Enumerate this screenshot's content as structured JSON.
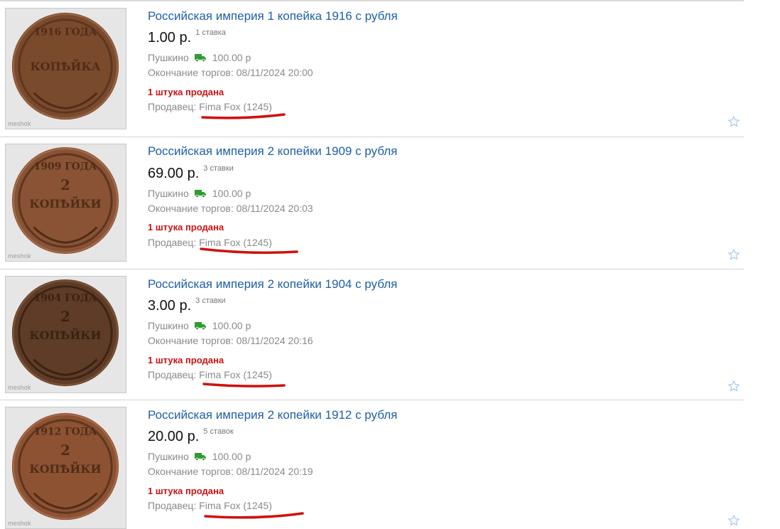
{
  "listings": [
    {
      "title": "Российская империя 1 копейка 1916 с рубля",
      "price": "1.00 р.",
      "bids": "1 ставка",
      "city": "Пушкино",
      "shipping": "100.00 р",
      "end": "Окончание торгов: 08/11/2024 20:00",
      "sold": "1 штука продана",
      "seller_label": "Продавец:",
      "seller_name": "Fima Fox (1245)",
      "watermark": "meshok"
    },
    {
      "title": "Российская империя 2 копейки 1909 с рубля",
      "price": "69.00 р.",
      "bids": "3 ставки",
      "city": "Пушкино",
      "shipping": "100.00 р",
      "end": "Окончание торгов: 08/11/2024 20:03",
      "sold": "1 штука продана",
      "seller_label": "Продавец:",
      "seller_name": "Fima Fox (1245)",
      "watermark": "meshok"
    },
    {
      "title": "Российская империя 2 копейки 1904 с рубля",
      "price": "3.00 р.",
      "bids": "3 ставки",
      "city": "Пушкино",
      "shipping": "100.00 р",
      "end": "Окончание торгов: 08/11/2024 20:16",
      "sold": "1 штука продана",
      "seller_label": "Продавец:",
      "seller_name": "Fima Fox (1245)",
      "watermark": "meshok"
    },
    {
      "title": "Российская империя 2 копейки 1912 с рубля",
      "price": "20.00 р.",
      "bids": "5 ставок",
      "city": "Пушкино",
      "shipping": "100.00 р",
      "end": "Окончание торгов: 08/11/2024 20:19",
      "sold": "1 штука продана",
      "seller_label": "Продавец:",
      "seller_name": "Fima Fox (1245)",
      "watermark": "meshok"
    }
  ],
  "icons": {
    "shipping": "truck-icon",
    "favorite": "star-outline-icon"
  },
  "colors": {
    "link": "#1f5fa8",
    "sold": "#cc1111",
    "muted": "#8a8a8a",
    "truck": "#2e9d2e",
    "star": "#a9c9ea",
    "annotation": "#d01010"
  }
}
